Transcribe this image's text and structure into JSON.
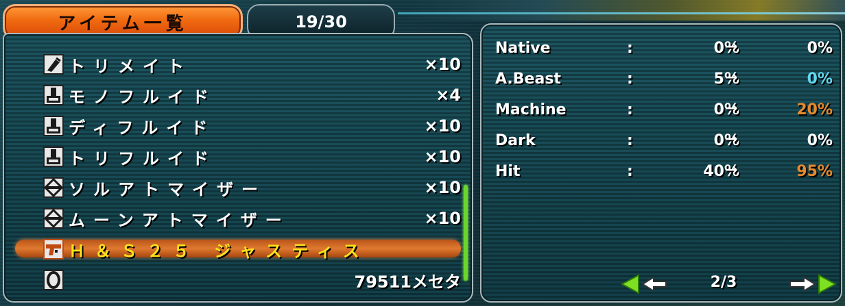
{
  "header": {
    "title": "アイテム一覧",
    "count": "19/30"
  },
  "items": [
    {
      "name": "トリメイト",
      "qty": "×10",
      "icon": "potion-icon"
    },
    {
      "name": "モノフルイド",
      "qty": "×4",
      "icon": "fluid-icon"
    },
    {
      "name": "ディフルイド",
      "qty": "×10",
      "icon": "fluid-icon"
    },
    {
      "name": "トリフルイド",
      "qty": "×10",
      "icon": "fluid-icon"
    },
    {
      "name": "ソルアトマイザー",
      "qty": "×10",
      "icon": "atomizer-icon"
    },
    {
      "name": "ムーンアトマイザー",
      "qty": "×10",
      "icon": "atomizer-icon"
    },
    {
      "name": "Ｈ＆Ｓ２５ ジャスティス",
      "qty": "",
      "icon": "handgun-icon",
      "selected": true
    },
    {
      "name": "",
      "qty": "79511メセタ",
      "icon": "meseta-icon"
    }
  ],
  "stats": [
    {
      "label": "Native",
      "colon": ":",
      "from": "0%",
      "arrow": "→",
      "to": "0%",
      "to_color": "white"
    },
    {
      "label": "A.Beast",
      "colon": ":",
      "from": "5%",
      "arrow": "→",
      "to": "0%",
      "to_color": "cyan"
    },
    {
      "label": "Machine",
      "colon": ":",
      "from": "0%",
      "arrow": "→",
      "to": "20%",
      "to_color": "orange"
    },
    {
      "label": "Dark",
      "colon": ":",
      "from": "0%",
      "arrow": "→",
      "to": "0%",
      "to_color": "white"
    },
    {
      "label": "Hit",
      "colon": ":",
      "from": "40%",
      "arrow": "→",
      "to": "95%",
      "to_color": "orange"
    }
  ],
  "pager": {
    "page": "2/3",
    "prev_icon": "arrow-left-icon",
    "next_icon": "arrow-right-icon"
  },
  "colors": {
    "accent_orange": "#e58a2e",
    "accent_cyan": "#62d6ef",
    "selected_text": "#ffe21a",
    "tab_orange": "#f06a10"
  }
}
